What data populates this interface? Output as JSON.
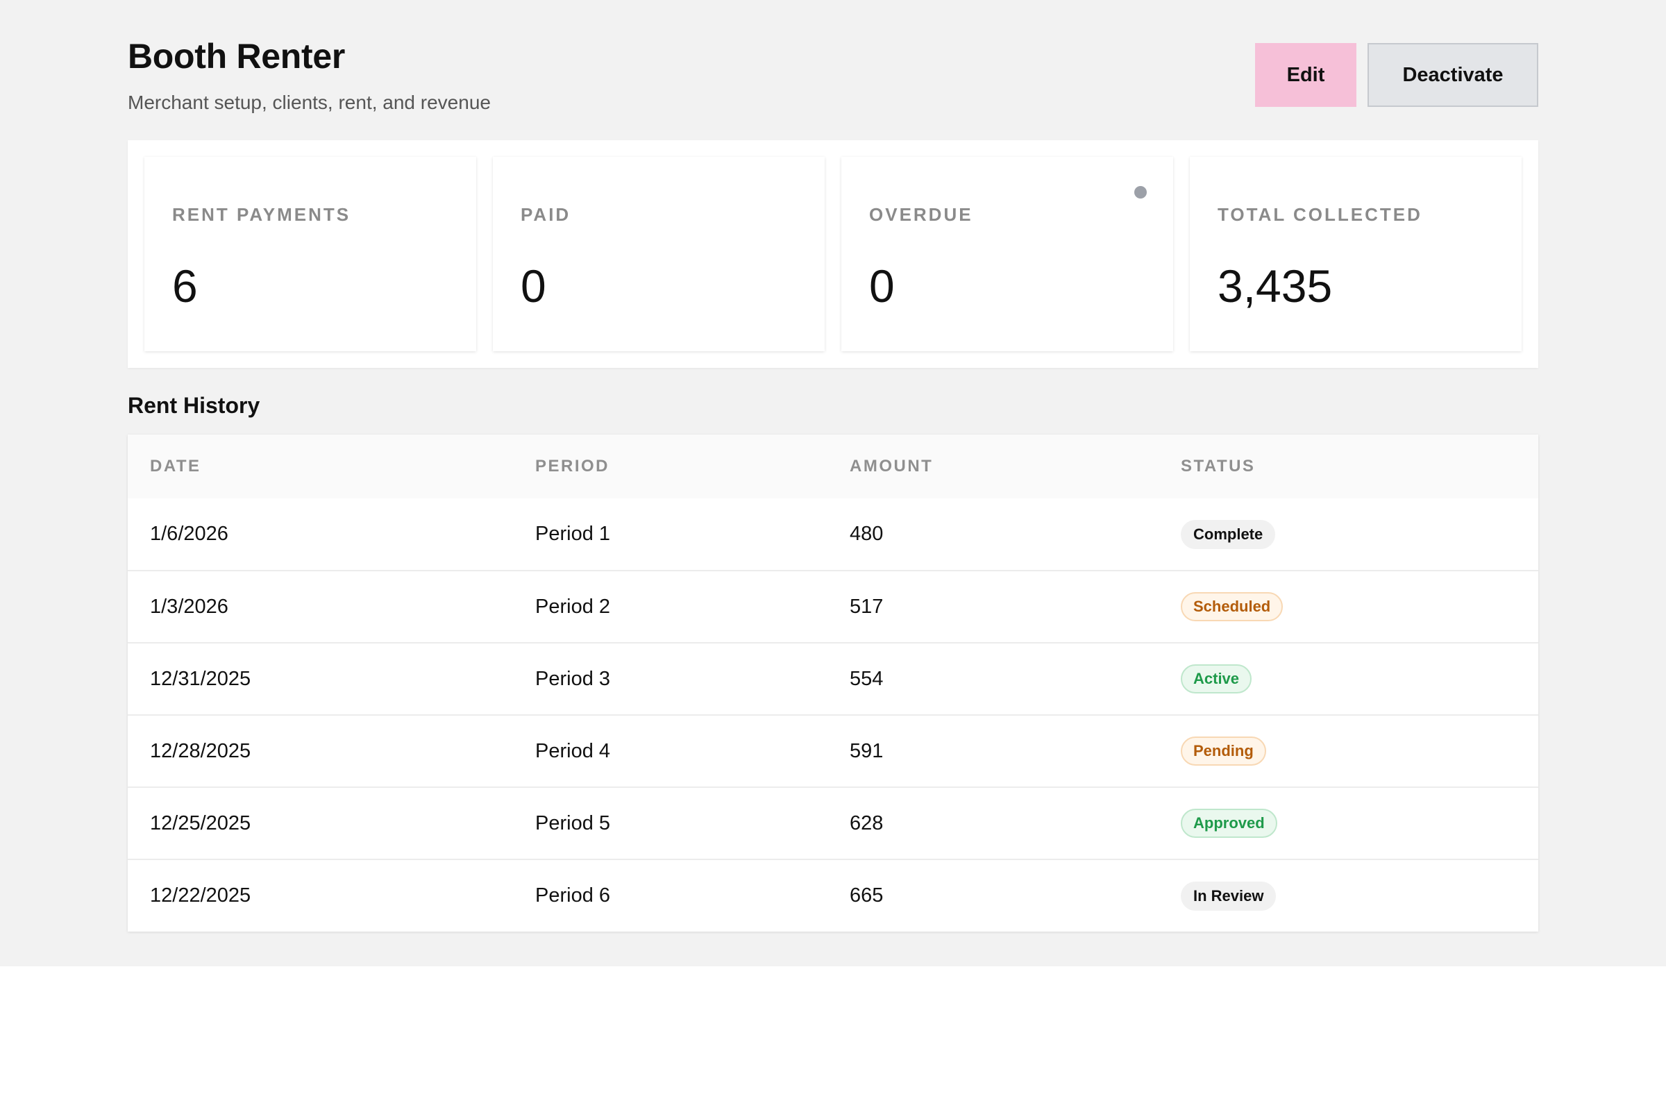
{
  "header": {
    "title": "Booth Renter",
    "subtitle": "Merchant setup, clients, rent, and revenue",
    "edit_label": "Edit",
    "deactivate_label": "Deactivate"
  },
  "stats": [
    {
      "label": "RENT PAYMENTS",
      "value": "6"
    },
    {
      "label": "PAID",
      "value": "0"
    },
    {
      "label": "OVERDUE",
      "value": "0"
    },
    {
      "label": "TOTAL COLLECTED",
      "value": "3,435"
    }
  ],
  "rent_history": {
    "title": "Rent History",
    "columns": [
      "DATE",
      "PERIOD",
      "AMOUNT",
      "STATUS"
    ],
    "rows": [
      {
        "date": "1/6/2026",
        "period": "Period 1",
        "amount": "480",
        "status": "Complete"
      },
      {
        "date": "1/3/2026",
        "period": "Period 2",
        "amount": "517",
        "status": "Scheduled"
      },
      {
        "date": "12/31/2025",
        "period": "Period 3",
        "amount": "554",
        "status": "Active"
      },
      {
        "date": "12/28/2025",
        "period": "Period 4",
        "amount": "591",
        "status": "Pending"
      },
      {
        "date": "12/25/2025",
        "period": "Period 5",
        "amount": "628",
        "status": "Approved"
      },
      {
        "date": "12/22/2025",
        "period": "Period 6",
        "amount": "665",
        "status": "In Review"
      }
    ]
  },
  "colors": {
    "edit_button": "#f6c0d8",
    "deactivate_button": "#e3e5e8",
    "badge_orange_text": "#b35c0a",
    "badge_green_text": "#1e9a4a",
    "indicator_dot": "#9ca0a8"
  },
  "icons": {
    "overdue_indicator": "status-dot-icon"
  }
}
